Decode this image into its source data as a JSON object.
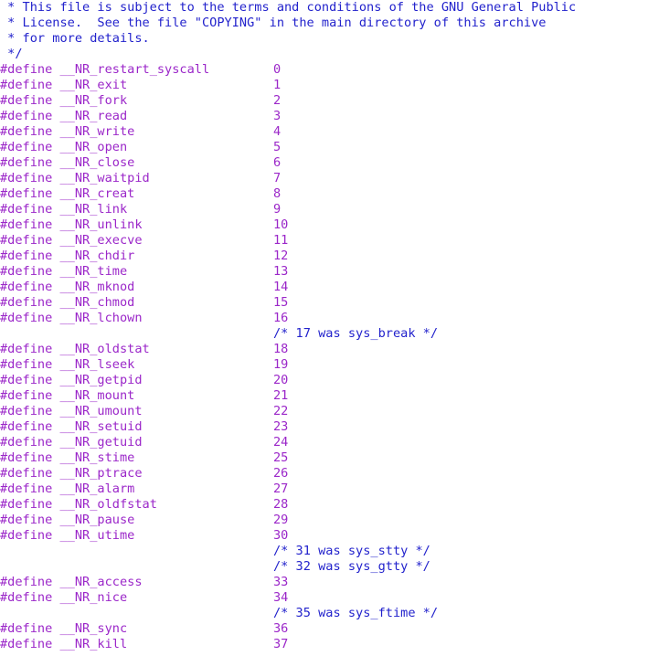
{
  "document": {
    "language": "c",
    "font_size_px": 13.6,
    "line_height_px": 17,
    "background_color": "#ffffff",
    "colors": {
      "comment": "#2222cc",
      "directive": "#9b27c9",
      "identifier": "#9b27c9",
      "number": "#9b27c9"
    }
  },
  "lines": [
    {
      "kind": "comment",
      "text": " * This file is subject to the terms and conditions of the GNU General Public"
    },
    {
      "kind": "comment",
      "text": " * License.  See the file \"COPYING\" in the main directory of this archive"
    },
    {
      "kind": "comment",
      "text": " * for more details."
    },
    {
      "kind": "comment",
      "text": " */"
    },
    {
      "kind": "define",
      "directive": "#define",
      "name": "__NR_restart_syscall",
      "value": "0"
    },
    {
      "kind": "define",
      "directive": "#define",
      "name": "__NR_exit",
      "value": "1"
    },
    {
      "kind": "define",
      "directive": "#define",
      "name": "__NR_fork",
      "value": "2"
    },
    {
      "kind": "define",
      "directive": "#define",
      "name": "__NR_read",
      "value": "3"
    },
    {
      "kind": "define",
      "directive": "#define",
      "name": "__NR_write",
      "value": "4"
    },
    {
      "kind": "define",
      "directive": "#define",
      "name": "__NR_open",
      "value": "5"
    },
    {
      "kind": "define",
      "directive": "#define",
      "name": "__NR_close",
      "value": "6"
    },
    {
      "kind": "define",
      "directive": "#define",
      "name": "__NR_waitpid",
      "value": "7"
    },
    {
      "kind": "define",
      "directive": "#define",
      "name": "__NR_creat",
      "value": "8"
    },
    {
      "kind": "define",
      "directive": "#define",
      "name": "__NR_link",
      "value": "9"
    },
    {
      "kind": "define",
      "directive": "#define",
      "name": "__NR_unlink",
      "value": "10"
    },
    {
      "kind": "define",
      "directive": "#define",
      "name": "__NR_execve",
      "value": "11"
    },
    {
      "kind": "define",
      "directive": "#define",
      "name": "__NR_chdir",
      "value": "12"
    },
    {
      "kind": "define",
      "directive": "#define",
      "name": "__NR_time",
      "value": "13"
    },
    {
      "kind": "define",
      "directive": "#define",
      "name": "__NR_mknod",
      "value": "14"
    },
    {
      "kind": "define",
      "directive": "#define",
      "name": "__NR_chmod",
      "value": "15"
    },
    {
      "kind": "define",
      "directive": "#define",
      "name": "__NR_lchown",
      "value": "16"
    },
    {
      "kind": "indented-comment",
      "text": "/* 17 was sys_break */"
    },
    {
      "kind": "define",
      "directive": "#define",
      "name": "__NR_oldstat",
      "value": "18"
    },
    {
      "kind": "define",
      "directive": "#define",
      "name": "__NR_lseek",
      "value": "19"
    },
    {
      "kind": "define",
      "directive": "#define",
      "name": "__NR_getpid",
      "value": "20"
    },
    {
      "kind": "define",
      "directive": "#define",
      "name": "__NR_mount",
      "value": "21"
    },
    {
      "kind": "define",
      "directive": "#define",
      "name": "__NR_umount",
      "value": "22"
    },
    {
      "kind": "define",
      "directive": "#define",
      "name": "__NR_setuid",
      "value": "23"
    },
    {
      "kind": "define",
      "directive": "#define",
      "name": "__NR_getuid",
      "value": "24"
    },
    {
      "kind": "define",
      "directive": "#define",
      "name": "__NR_stime",
      "value": "25"
    },
    {
      "kind": "define",
      "directive": "#define",
      "name": "__NR_ptrace",
      "value": "26"
    },
    {
      "kind": "define",
      "directive": "#define",
      "name": "__NR_alarm",
      "value": "27"
    },
    {
      "kind": "define",
      "directive": "#define",
      "name": "__NR_oldfstat",
      "value": "28"
    },
    {
      "kind": "define",
      "directive": "#define",
      "name": "__NR_pause",
      "value": "29"
    },
    {
      "kind": "define",
      "directive": "#define",
      "name": "__NR_utime",
      "value": "30"
    },
    {
      "kind": "indented-comment",
      "text": "/* 31 was sys_stty */"
    },
    {
      "kind": "indented-comment",
      "text": "/* 32 was sys_gtty */"
    },
    {
      "kind": "define",
      "directive": "#define",
      "name": "__NR_access",
      "value": "33"
    },
    {
      "kind": "define",
      "directive": "#define",
      "name": "__NR_nice",
      "value": "34"
    },
    {
      "kind": "indented-comment",
      "text": "/* 35 was sys_ftime */"
    },
    {
      "kind": "define",
      "directive": "#define",
      "name": "__NR_sync",
      "value": "36"
    },
    {
      "kind": "define",
      "directive": "#define",
      "name": "__NR_kill",
      "value": "37"
    }
  ]
}
